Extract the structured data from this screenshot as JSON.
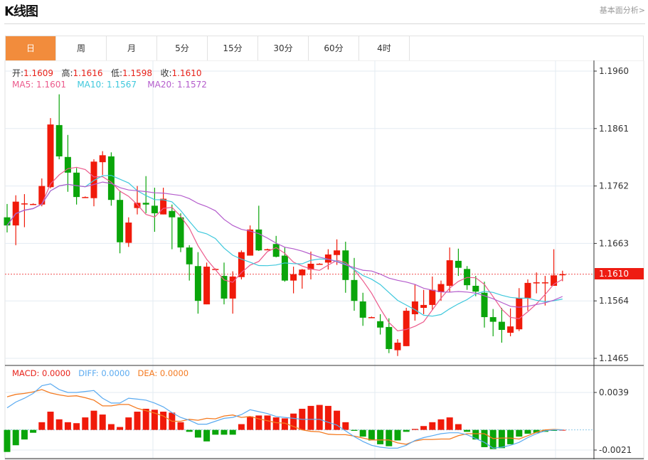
{
  "header": {
    "title": "K线图",
    "link": "基本面分析>"
  },
  "tabs": [
    {
      "label": "日",
      "active": true
    },
    {
      "label": "周"
    },
    {
      "label": "月"
    },
    {
      "label": "5分"
    },
    {
      "label": "15分"
    },
    {
      "label": "30分"
    },
    {
      "label": "60分"
    },
    {
      "label": "4时"
    }
  ],
  "ohlc_legend": {
    "open_label": "开:",
    "open": "1.1609",
    "high_label": "高:",
    "high": "1.1616",
    "low_label": "低:",
    "low": "1.1598",
    "close_label": "收:",
    "close": "1.1610"
  },
  "ma_legend": {
    "ma5": "MA5: 1.1601",
    "ma10": "MA10: 1.1567",
    "ma20": "MA20: 1.1572"
  },
  "macd_legend": {
    "macd": "MACD: 0.0000",
    "diff": "DIFF: 0.0000",
    "dea": "DEA: 0.0000"
  },
  "current_price": "1.1610",
  "colors": {
    "up": "#f01a0a",
    "down": "#0aa50a",
    "ma5": "#ec5a8c",
    "ma10": "#3ec8dc",
    "ma20": "#b45ccc",
    "diff": "#5aaaf0",
    "dea": "#f47a20",
    "accent": "#f28c3c"
  },
  "chart_data": [
    {
      "type": "candlestick",
      "ylim": [
        1.1465,
        1.196
      ],
      "yticks": [
        "1.1960",
        "1.1861",
        "1.1762",
        "1.1663",
        "1.1564",
        "1.1465"
      ],
      "grid": true,
      "candles": [
        [
          1.1708,
          1.1731,
          1.1682,
          1.1694
        ],
        [
          1.1694,
          1.1746,
          1.166,
          1.1735
        ],
        [
          1.1731,
          1.1748,
          1.1691,
          1.1732
        ],
        [
          1.1731,
          1.1732,
          1.173,
          1.1731
        ],
        [
          1.173,
          1.1775,
          1.1727,
          1.1762
        ],
        [
          1.176,
          1.1879,
          1.1758,
          1.1868
        ],
        [
          1.1867,
          1.192,
          1.1808,
          1.1813
        ],
        [
          1.1812,
          1.185,
          1.1752,
          1.1785
        ],
        [
          1.1785,
          1.1793,
          1.173,
          1.1743
        ],
        [
          1.1743,
          1.1744,
          1.1742,
          1.1743
        ],
        [
          1.1741,
          1.1808,
          1.1727,
          1.1804
        ],
        [
          1.1803,
          1.1822,
          1.1781,
          1.1815
        ],
        [
          1.1813,
          1.182,
          1.1728,
          1.1738
        ],
        [
          1.1738,
          1.1754,
          1.1646,
          1.1665
        ],
        [
          1.1664,
          1.1708,
          1.1657,
          1.1699
        ],
        [
          1.1724,
          1.1762,
          1.1713,
          1.1733
        ],
        [
          1.1733,
          1.1779,
          1.1715,
          1.173
        ],
        [
          1.1728,
          1.1759,
          1.1683,
          1.1715
        ],
        [
          1.1713,
          1.1759,
          1.1713,
          1.174
        ],
        [
          1.1719,
          1.173,
          1.1653,
          1.1708
        ],
        [
          1.1708,
          1.1715,
          1.1648,
          1.1656
        ],
        [
          1.1656,
          1.166,
          1.1599,
          1.1627
        ],
        [
          1.1624,
          1.1648,
          1.1542,
          1.1564
        ],
        [
          1.1558,
          1.163,
          1.1558,
          1.1623
        ],
        [
          1.1619,
          1.162,
          1.1618,
          1.1619
        ],
        [
          1.1607,
          1.163,
          1.1558,
          1.1568
        ],
        [
          1.1568,
          1.1615,
          1.1542,
          1.1606
        ],
        [
          1.1605,
          1.1651,
          1.1601,
          1.1648
        ],
        [
          1.1642,
          1.1694,
          1.1642,
          1.1687
        ],
        [
          1.1687,
          1.1728,
          1.165,
          1.1651
        ],
        [
          1.1653,
          1.1654,
          1.1652,
          1.1653
        ],
        [
          1.1662,
          1.1676,
          1.1639,
          1.164
        ],
        [
          1.1642,
          1.1656,
          1.1597,
          1.1599
        ],
        [
          1.1599,
          1.1623,
          1.1577,
          1.161
        ],
        [
          1.1608,
          1.1619,
          1.1585,
          1.1618
        ],
        [
          1.1618,
          1.1649,
          1.1601,
          1.1628
        ],
        [
          1.1628,
          1.1629,
          1.1627,
          1.1628
        ],
        [
          1.163,
          1.1653,
          1.1618,
          1.1644
        ],
        [
          1.1643,
          1.167,
          1.1626,
          1.1651
        ],
        [
          1.1651,
          1.1666,
          1.1578,
          1.16
        ],
        [
          1.16,
          1.1638,
          1.1547,
          1.1564
        ],
        [
          1.1563,
          1.1578,
          1.1521,
          1.1535
        ],
        [
          1.1536,
          1.1537,
          1.1535,
          1.1536
        ],
        [
          1.1529,
          1.1541,
          1.1506,
          1.1518
        ],
        [
          1.1519,
          1.1534,
          1.1474,
          1.1481
        ],
        [
          1.1479,
          1.1498,
          1.1469,
          1.1492
        ],
        [
          1.1486,
          1.1552,
          1.1486,
          1.1547
        ],
        [
          1.1541,
          1.1593,
          1.153,
          1.1563
        ],
        [
          1.1552,
          1.1583,
          1.1541,
          1.1557
        ],
        [
          1.1557,
          1.1606,
          1.1548,
          1.1583
        ],
        [
          1.1579,
          1.1599,
          1.1564,
          1.1593
        ],
        [
          1.159,
          1.1656,
          1.1579,
          1.1634
        ],
        [
          1.1633,
          1.1654,
          1.1607,
          1.1621
        ],
        [
          1.1619,
          1.1624,
          1.1583,
          1.1591
        ],
        [
          1.159,
          1.1607,
          1.1572,
          1.158
        ],
        [
          1.1578,
          1.1597,
          1.1518,
          1.1536
        ],
        [
          1.1536,
          1.155,
          1.1503,
          1.1528
        ],
        [
          1.1528,
          1.1552,
          1.1492,
          1.1514
        ],
        [
          1.1509,
          1.1551,
          1.1503,
          1.152
        ],
        [
          1.1515,
          1.1586,
          1.1512,
          1.1569
        ],
        [
          1.1569,
          1.1601,
          1.1547,
          1.1595
        ],
        [
          1.1595,
          1.1613,
          1.1577,
          1.1596
        ],
        [
          1.1595,
          1.1607,
          1.1556,
          1.1596
        ],
        [
          1.159,
          1.1653,
          1.159,
          1.1608
        ],
        [
          1.1609,
          1.1616,
          1.1598,
          1.161
        ]
      ],
      "candle_format": [
        "open",
        "high",
        "low",
        "close"
      ],
      "moving_averages": [
        "MA5",
        "MA10",
        "MA20"
      ]
    },
    {
      "type": "bar+line",
      "ylim": [
        -0.0021,
        0.0039
      ],
      "yticks": [
        "0.0039",
        "-0.0021"
      ],
      "macd": [
        -0.0023,
        -0.0016,
        -0.001,
        -0.0003,
        0.0008,
        0.0019,
        0.0011,
        0.0008,
        0.0007,
        0.0013,
        0.002,
        0.0016,
        0.0006,
        0.0003,
        0.0013,
        0.0019,
        0.0022,
        0.0021,
        0.0019,
        0.0018,
        0.0008,
        -0.0002,
        -0.0008,
        -0.0012,
        -0.0005,
        -0.0005,
        -0.0005,
        0.0006,
        0.0014,
        0.0015,
        0.0015,
        0.0013,
        0.0012,
        0.0017,
        0.0022,
        0.0025,
        0.0026,
        0.0025,
        0.002,
        0.0008,
        -0.0001,
        -0.0007,
        -0.0011,
        -0.0015,
        -0.0017,
        -0.0011,
        -0.0002,
        0.0001,
        0.0004,
        0.0008,
        0.0011,
        0.0013,
        0.0006,
        -0.0002,
        -0.001,
        -0.0018,
        -0.002,
        -0.0019,
        -0.0015,
        -0.0007,
        -0.0004,
        -0.0003,
        -0.0002,
        -0.0001,
        0.0
      ],
      "diff": [
        0.0023,
        0.0029,
        0.0033,
        0.0038,
        0.0046,
        0.0048,
        0.0042,
        0.0039,
        0.0039,
        0.004,
        0.0041,
        0.0033,
        0.0028,
        0.0028,
        0.0033,
        0.0032,
        0.0031,
        0.0028,
        0.0024,
        0.0018,
        0.0013,
        0.001,
        0.0006,
        0.0006,
        0.0009,
        0.0012,
        0.0013,
        0.0016,
        0.0021,
        0.0019,
        0.0017,
        0.0014,
        0.0013,
        0.0012,
        0.0011,
        0.0011,
        0.0011,
        0.0008,
        0.0005,
        -0.0001,
        -0.0007,
        -0.0012,
        -0.0016,
        -0.0018,
        -0.0019,
        -0.0019,
        -0.0016,
        -0.0011,
        -0.0008,
        -0.0006,
        -0.0004,
        -0.0003,
        -0.0003,
        -0.0005,
        -0.0009,
        -0.0013,
        -0.0019,
        -0.0018,
        -0.0016,
        -0.0013,
        -0.0008,
        -0.0004,
        -0.0001,
        0.0,
        0.0
      ]
    }
  ]
}
